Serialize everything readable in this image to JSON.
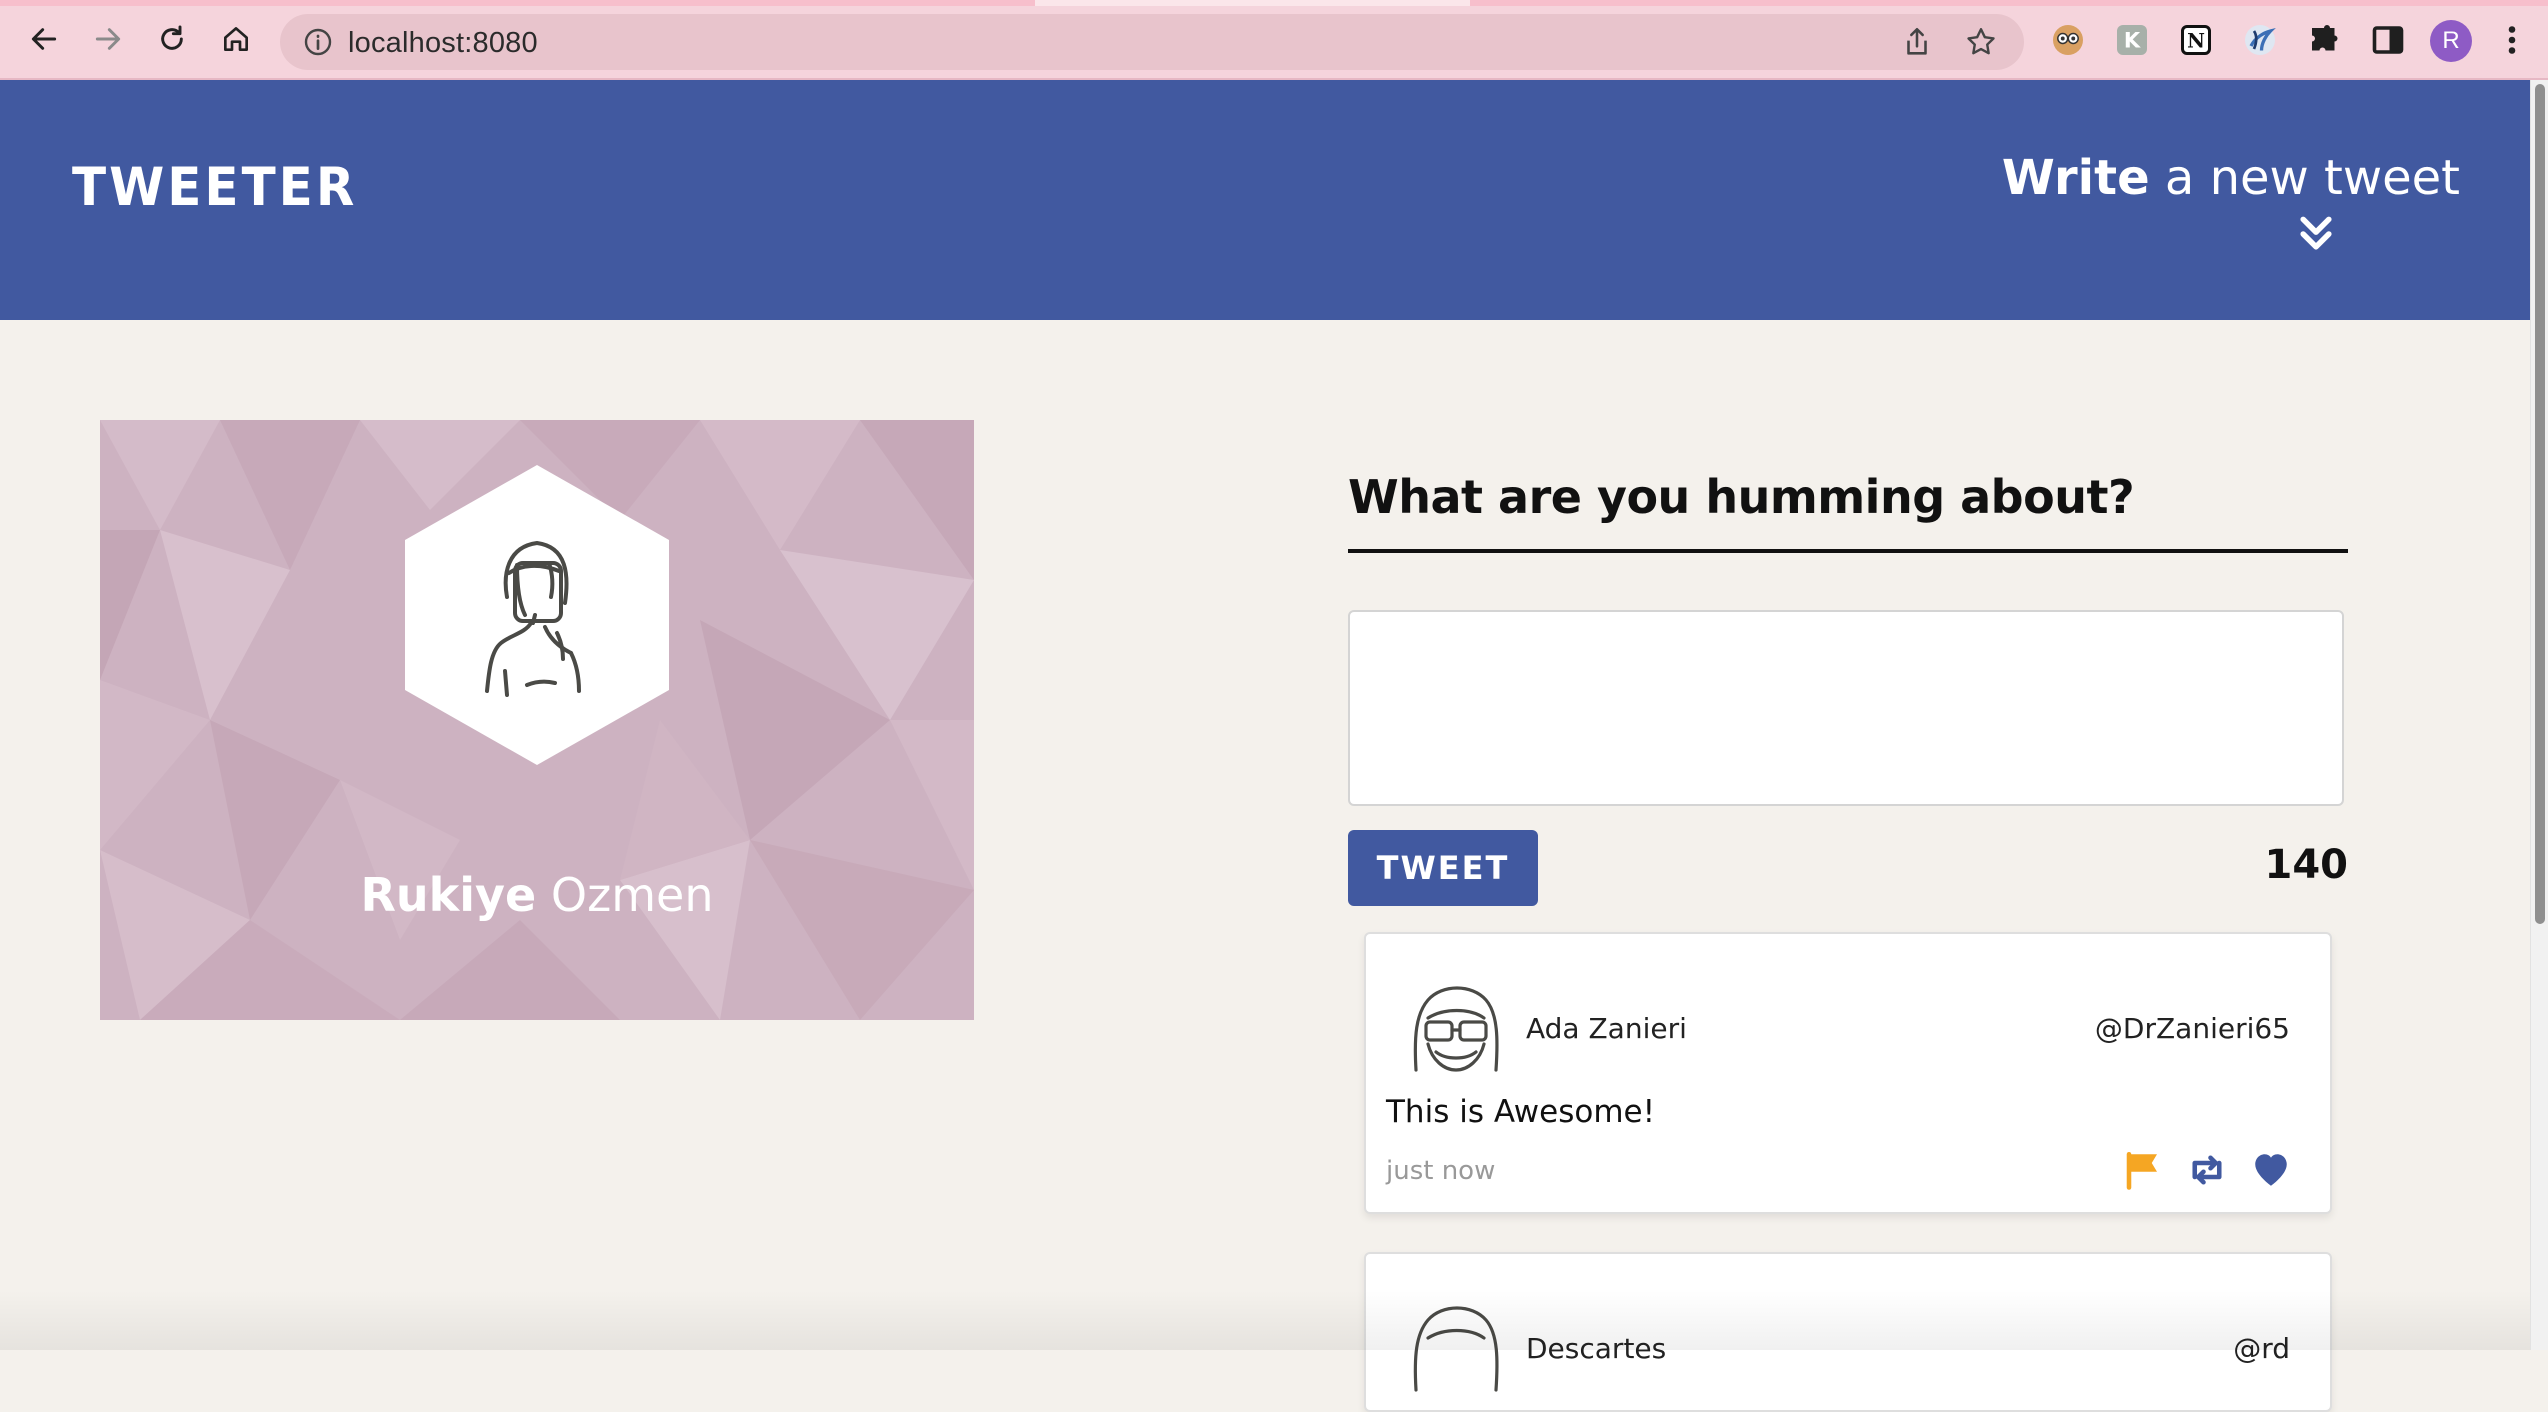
{
  "browser": {
    "url": "localhost:8080",
    "profile_initial": "R",
    "icons": [
      "back-icon",
      "forward-icon",
      "reload-icon",
      "home-icon",
      "info-icon",
      "share-icon",
      "star-icon",
      "extension-owl-icon",
      "extension-k-icon",
      "notion-icon",
      "extension-swirl-icon",
      "puzzle-icon",
      "sidepanel-icon",
      "kebab-menu-icon"
    ]
  },
  "header": {
    "brand": "TWEETER",
    "compose_link_bold": "Write",
    "compose_link_rest": " a new tweet",
    "bg_color": "#4159a0"
  },
  "profile": {
    "first_name": "Rukiye",
    "last_name": " Ozmen",
    "card_color": "#cdb2c1"
  },
  "compose": {
    "title": "What are you humming about?",
    "placeholder": "",
    "button_label": "TWEET",
    "counter": "140"
  },
  "tweets": [
    {
      "name": "Ada Zanieri",
      "handle": "@DrZanieri65",
      "content": "This is Awesome!",
      "time": "just now"
    },
    {
      "name": "Descartes",
      "handle": "@rd",
      "content": "",
      "time": ""
    }
  ],
  "colors": {
    "accent": "#4159a0",
    "flag": "#f5a623",
    "page_bg": "#f4f1ec"
  }
}
